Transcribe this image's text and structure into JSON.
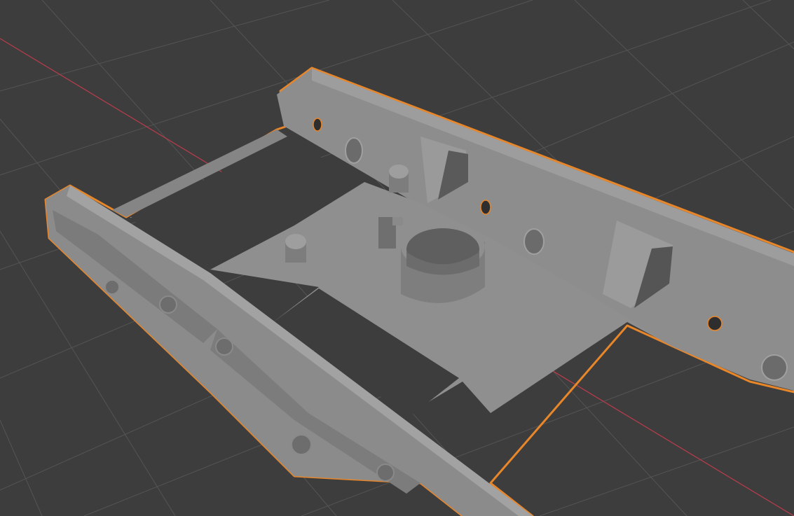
{
  "viewport": {
    "name": "3D Viewport",
    "background_color": "#3d3d3d",
    "grid": true,
    "grid_line_color": "#555555",
    "x_axis_color": "#c0404f",
    "selection_outline_color": "#f0882a",
    "object_color": "#8f8f8f",
    "object_shadow_color": "#6e6e6e",
    "object_highlight_color": "#a6a6a6"
  },
  "object": {
    "name": "bogie-frame",
    "selected": true,
    "features": [
      "side-frame-front",
      "side-frame-back",
      "bolster",
      "transom",
      "center-pivot-cup",
      "mounting-pins",
      "spring-pockets",
      "brake-hangers"
    ]
  }
}
